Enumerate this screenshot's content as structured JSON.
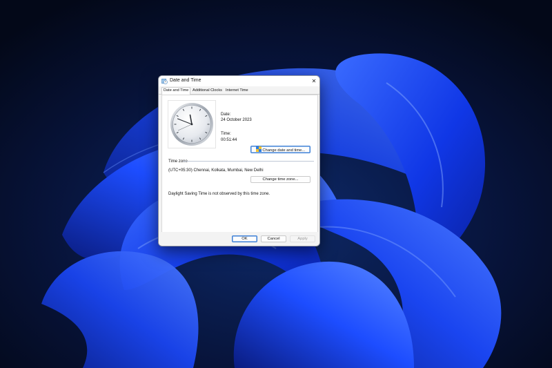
{
  "window": {
    "title": "Date and Time",
    "close_glyph": "✕"
  },
  "tabs": [
    {
      "label": "Date and Time",
      "active": true
    },
    {
      "label": "Additional Clocks",
      "active": false
    },
    {
      "label": "Internet Time",
      "active": false
    }
  ],
  "date_section": {
    "date_label": "Date:",
    "date_value": "24 October 2023",
    "time_label": "Time:",
    "time_value": "00:51:44",
    "change_button": "Change date and time..."
  },
  "timezone_section": {
    "heading": "Time zone",
    "value": "(UTC+05:30) Chennai, Kolkata, Mumbai, New Delhi",
    "change_button": "Change time zone...",
    "dst_note": "Daylight Saving Time is not observed by this time zone."
  },
  "footer": {
    "ok": "OK",
    "cancel": "Cancel",
    "apply": "Apply"
  },
  "icons": {
    "app": "calendar-clock-icon",
    "change_date": "shield-icon",
    "close": "close-icon"
  },
  "colors": {
    "accent": "#3c7fd6",
    "wallpaper_base": "#050c24",
    "bloom": "#1a4cff"
  }
}
